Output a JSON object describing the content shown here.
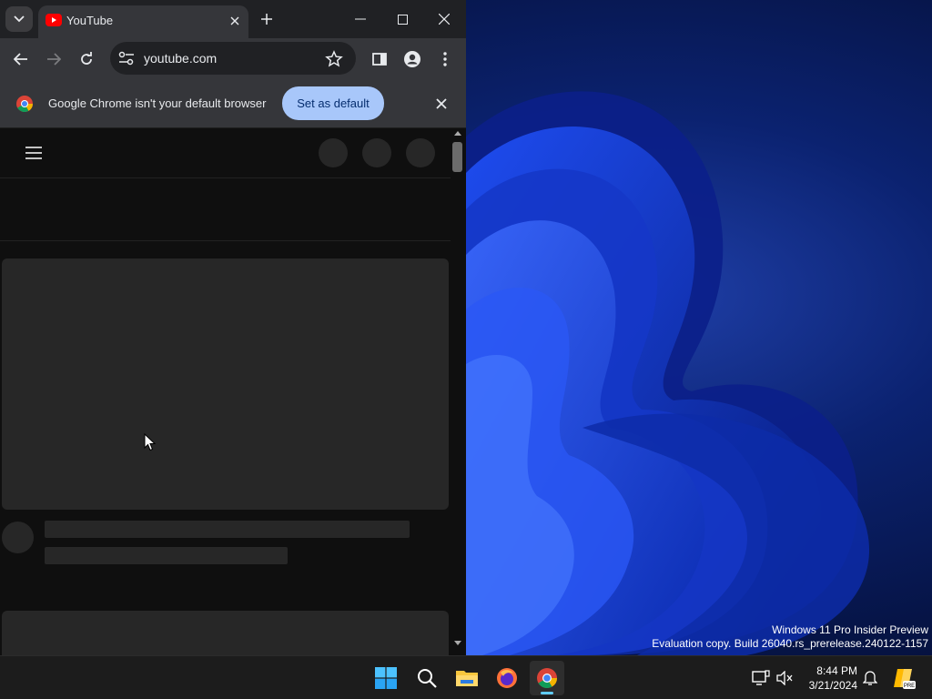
{
  "browser": {
    "tab": {
      "title": "YouTube"
    },
    "omnibox": {
      "url": "youtube.com"
    },
    "infobar": {
      "message": "Google Chrome isn't your default browser",
      "button": "Set as default"
    }
  },
  "desktop": {
    "watermark_line1": "Windows 11 Pro Insider Preview",
    "watermark_line2": "Evaluation copy. Build 26040.rs_prerelease.240122-1157"
  },
  "taskbar": {
    "apps": [
      "start-icon",
      "search-icon",
      "file-explorer-icon",
      "firefox-icon",
      "chrome-icon"
    ],
    "active_app": "chrome-icon",
    "time": "8:44 PM",
    "date": "3/21/2024"
  },
  "colors": {
    "accent": "#a8c7fa",
    "youtube_red": "#ff0000",
    "page_bg": "#0f0f0f",
    "skeleton": "#272727"
  }
}
